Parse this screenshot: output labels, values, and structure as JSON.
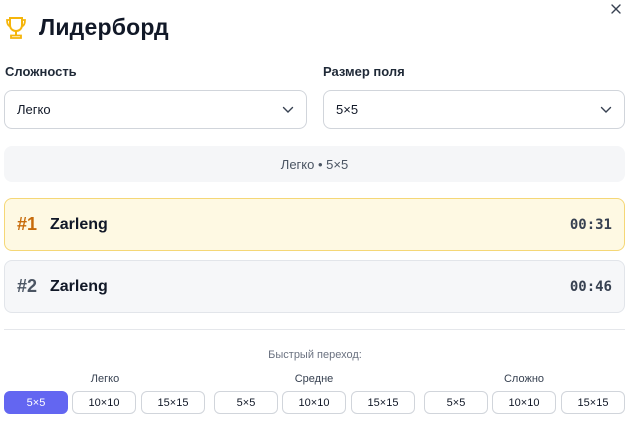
{
  "header": {
    "title": "Лидерборд",
    "icon": "trophy-icon",
    "icon_color": "#f5b50b"
  },
  "filters": {
    "difficulty": {
      "label": "Сложность",
      "value": "Легко"
    },
    "board_size": {
      "label": "Размер поля",
      "value": "5×5"
    }
  },
  "summary": "Легко • 5×5",
  "leaders": [
    {
      "rank": "#1",
      "name": "Zarleng",
      "time": "00:31"
    },
    {
      "rank": "#2",
      "name": "Zarleng",
      "time": "00:46"
    }
  ],
  "quick_jump": {
    "label": "Быстрый переход:",
    "groups": [
      {
        "name": "Легко",
        "sizes": [
          "5×5",
          "10×10",
          "15×15"
        ]
      },
      {
        "name": "Средне",
        "sizes": [
          "5×5",
          "10×10",
          "15×15"
        ]
      },
      {
        "name": "Сложно",
        "sizes": [
          "5×5",
          "10×10",
          "15×15"
        ]
      }
    ]
  },
  "colors": {
    "accent": "#6366f1",
    "gold": "#f5d776",
    "gold_rank": "#c76b0a"
  }
}
